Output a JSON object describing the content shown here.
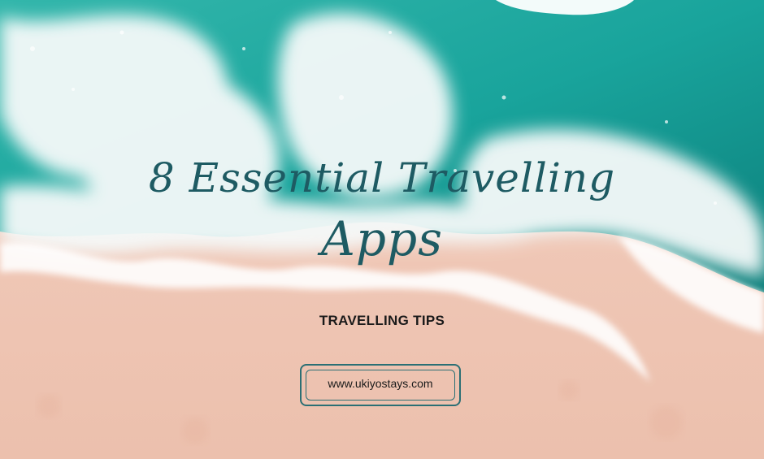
{
  "heading": {
    "line1": "8 Essential Travelling",
    "line2": "Apps"
  },
  "subtitle": "TRAVELLING TIPS",
  "url": "www.ukiyostays.com",
  "colors": {
    "ocean": "#1aa89e",
    "ocean_deep": "#0f7f7c",
    "foam": "#f4f8f8",
    "sand": "#f0c9b8",
    "title_text": "#1e5b63",
    "border": "#2b6f74",
    "text_dark": "#1a1a1a"
  }
}
